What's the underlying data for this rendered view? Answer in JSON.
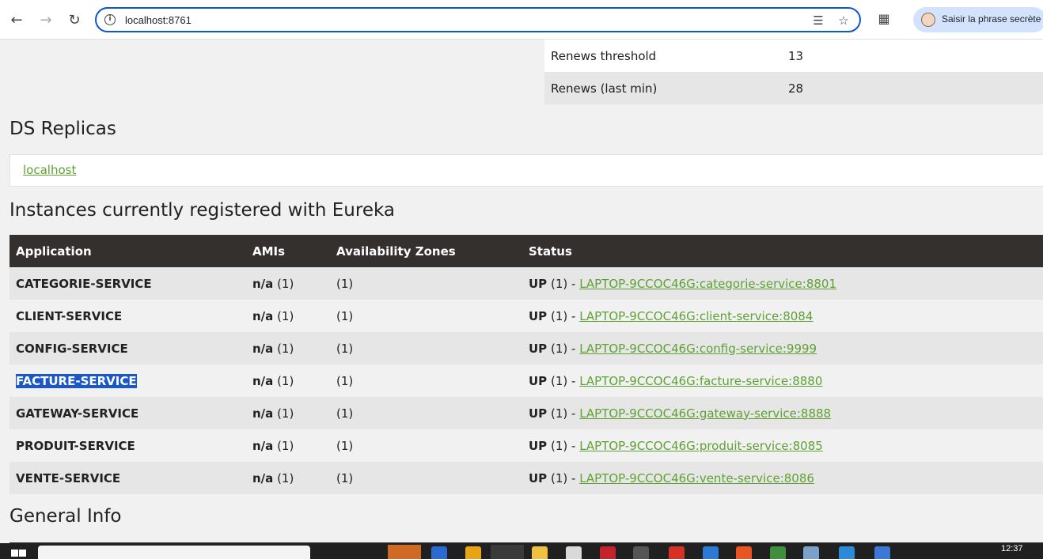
{
  "browser": {
    "url": "localhost:8761",
    "profile_label": "Saisir la phrase secrète"
  },
  "renews": [
    {
      "label": "Renews threshold",
      "value": "13"
    },
    {
      "label": "Renews (last min)",
      "value": "28"
    }
  ],
  "ds_replicas": {
    "heading": "DS Replicas",
    "link": "localhost"
  },
  "instances": {
    "heading": "Instances currently registered with Eureka",
    "columns": [
      "Application",
      "AMIs",
      "Availability Zones",
      "Status"
    ],
    "rows": [
      {
        "app": "CATEGORIE-SERVICE",
        "ami": "n/a",
        "ami_count": "(1)",
        "zones": "(1)",
        "status": "UP",
        "status_count": "(1) -",
        "link": "LAPTOP-9CCOC46G:categorie-service:8801"
      },
      {
        "app": "CLIENT-SERVICE",
        "ami": "n/a",
        "ami_count": "(1)",
        "zones": "(1)",
        "status": "UP",
        "status_count": "(1) -",
        "link": "LAPTOP-9CCOC46G:client-service:8084"
      },
      {
        "app": "CONFIG-SERVICE",
        "ami": "n/a",
        "ami_count": "(1)",
        "zones": "(1)",
        "status": "UP",
        "status_count": "(1) -",
        "link": "LAPTOP-9CCOC46G:config-service:9999"
      },
      {
        "app": "FACTURE-SERVICE",
        "ami": "n/a",
        "ami_count": "(1)",
        "zones": "(1)",
        "status": "UP",
        "status_count": "(1) -",
        "link": "LAPTOP-9CCOC46G:facture-service:8880"
      },
      {
        "app": "GATEWAY-SERVICE",
        "ami": "n/a",
        "ami_count": "(1)",
        "zones": "(1)",
        "status": "UP",
        "status_count": "(1) -",
        "link": "LAPTOP-9CCOC46G:gateway-service:8888"
      },
      {
        "app": "PRODUIT-SERVICE",
        "ami": "n/a",
        "ami_count": "(1)",
        "zones": "(1)",
        "status": "UP",
        "status_count": "(1) -",
        "link": "LAPTOP-9CCOC46G:produit-service:8085"
      },
      {
        "app": "VENTE-SERVICE",
        "ami": "n/a",
        "ami_count": "(1)",
        "zones": "(1)",
        "status": "UP",
        "status_count": "(1) -",
        "link": "LAPTOP-9CCOC46G:vente-service:8086"
      }
    ]
  },
  "general_info": {
    "heading": "General Info"
  },
  "taskbar": {
    "clock": "12:37"
  },
  "colors": {
    "link": "#5fa134",
    "table_header": "#34302d",
    "selection": "#1a57c9",
    "omnibox_focus": "#0b57d0"
  }
}
